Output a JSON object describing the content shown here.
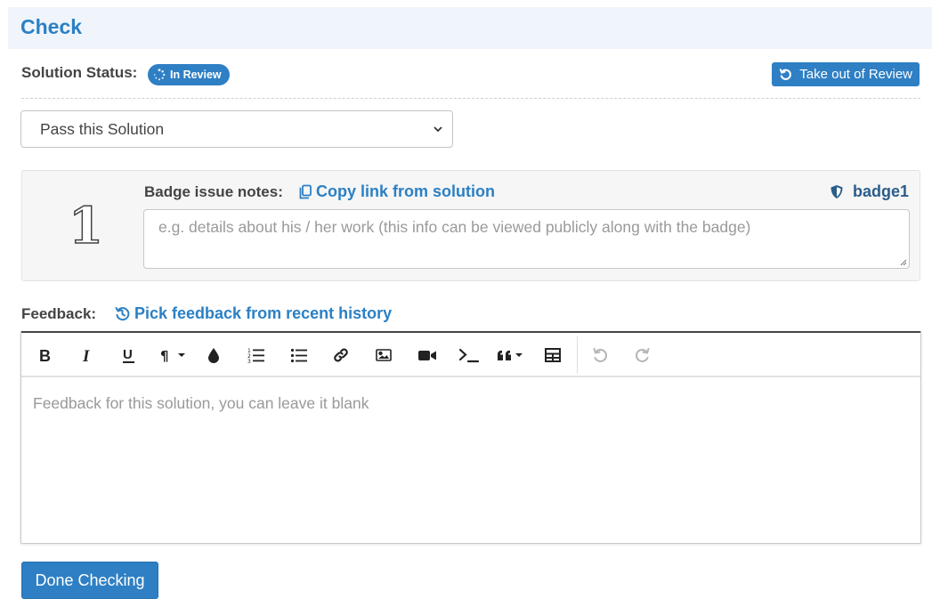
{
  "header": {
    "title": "Check"
  },
  "status": {
    "label": "Solution Status:",
    "badge": "In Review",
    "badge_icon": "spinner-icon",
    "take_out_label": "Take out of Review",
    "take_out_icon": "undo-icon"
  },
  "decision": {
    "selected": "Pass this Solution",
    "icon": "chevron-down-icon"
  },
  "badge_panel": {
    "number": "1",
    "notes_label": "Badge issue notes:",
    "copy_link_label": "Copy link from solution",
    "copy_icon": "copy-icon",
    "badge_name": "badge1",
    "badge_icon": "shield-icon",
    "notes_placeholder": "e.g. details about his / her work (this info can be viewed publicly along with the badge)"
  },
  "feedback": {
    "label": "Feedback:",
    "history_label": "Pick feedback from recent history",
    "history_icon": "history-icon",
    "toolbar": [
      "bold-icon",
      "italic-icon",
      "underline-icon",
      "paragraph-icon",
      "color-drop-icon",
      "ordered-list-icon",
      "unordered-list-icon",
      "link-icon",
      "image-icon",
      "video-icon",
      "code-icon",
      "quote-icon",
      "table-icon",
      "undo-icon",
      "redo-icon"
    ],
    "placeholder": "Feedback for this solution, you can leave it blank"
  },
  "done_label": "Done Checking",
  "colors": {
    "accent": "#2e7fc4",
    "header_bg": "#f0f5fb",
    "badge_name": "#2a5d8a"
  }
}
